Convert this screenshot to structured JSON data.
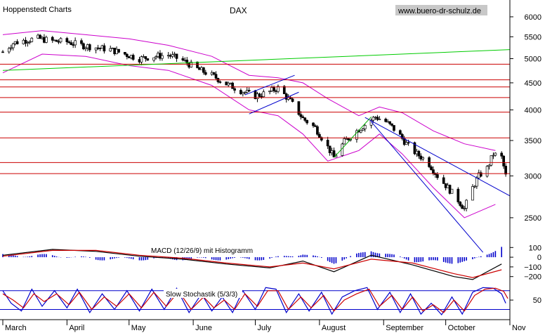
{
  "header": {
    "source": "Hoppenstedt Charts",
    "title": "DAX",
    "url": "www.buero-dr-schulz.de"
  },
  "colors": {
    "background": "#ffffff",
    "axis": "#000000",
    "candle_up": "#ffffff",
    "candle_down": "#000000",
    "bollinger": "#cc00cc",
    "support_resistance": "#cc0000",
    "long_trend": "#00cc00",
    "short_trend": "#00aa00",
    "trend_channel": "#0000cc",
    "macd": "#000000",
    "macd_signal": "#cc0000",
    "histogram": "#0000cc",
    "stoch_k": "#0000cc",
    "stoch_d": "#cc0000",
    "stoch_level": "#0000cc",
    "url_bg": "#c8c8c8"
  },
  "chart_data": [
    {
      "type": "candlestick",
      "name": "price",
      "title": "DAX",
      "y_scale": "log",
      "ylim": [
        2280,
        6300
      ],
      "y_ticks": [
        2500,
        3000,
        3500,
        4000,
        4500,
        5000,
        5500,
        6000
      ],
      "x_range": [
        "2002-03-01",
        "2002-11-01"
      ],
      "x_ticks": [
        {
          "date": "2002-03-01",
          "label": "March"
        },
        {
          "date": "2002-04-01",
          "label": "April"
        },
        {
          "date": "2002-05-01",
          "label": "May"
        },
        {
          "date": "2002-06-01",
          "label": "June"
        },
        {
          "date": "2002-07-01",
          "label": "July"
        },
        {
          "date": "2002-08-01",
          "label": "August"
        },
        {
          "date": "2002-09-01",
          "label": "September"
        },
        {
          "date": "2002-10-01",
          "label": "October"
        },
        {
          "date": "2002-11-01",
          "label": "Nov"
        }
      ],
      "close_path": [
        [
          "2002-03-01",
          5150
        ],
        [
          "2002-03-06",
          5350
        ],
        [
          "2002-03-12",
          5420
        ],
        [
          "2002-03-18",
          5460
        ],
        [
          "2002-03-25",
          5400
        ],
        [
          "2002-04-01",
          5380
        ],
        [
          "2002-04-08",
          5300
        ],
        [
          "2002-04-15",
          5250
        ],
        [
          "2002-04-22",
          5200
        ],
        [
          "2002-04-29",
          5100
        ],
        [
          "2002-05-06",
          5000
        ],
        [
          "2002-05-13",
          5050
        ],
        [
          "2002-05-20",
          5080
        ],
        [
          "2002-05-27",
          4960
        ],
        [
          "2002-06-03",
          4780
        ],
        [
          "2002-06-10",
          4650
        ],
        [
          "2002-06-17",
          4480
        ],
        [
          "2002-06-24",
          4350
        ],
        [
          "2002-07-01",
          4250
        ],
        [
          "2002-07-06",
          4300
        ],
        [
          "2002-07-12",
          4400
        ],
        [
          "2002-07-18",
          4150
        ],
        [
          "2002-07-24",
          3850
        ],
        [
          "2002-07-30",
          3700
        ],
        [
          "2002-08-03",
          3500
        ],
        [
          "2002-08-08",
          3250
        ],
        [
          "2002-08-13",
          3480
        ],
        [
          "2002-08-19",
          3650
        ],
        [
          "2002-08-23",
          3750
        ],
        [
          "2002-08-28",
          3880
        ],
        [
          "2002-09-02",
          3800
        ],
        [
          "2002-09-07",
          3650
        ],
        [
          "2002-09-12",
          3450
        ],
        [
          "2002-09-17",
          3300
        ],
        [
          "2002-09-22",
          3200
        ],
        [
          "2002-09-27",
          3000
        ],
        [
          "2002-10-02",
          2850
        ],
        [
          "2002-10-07",
          2700
        ],
        [
          "2002-10-10",
          2600
        ],
        [
          "2002-10-14",
          2850
        ],
        [
          "2002-10-17",
          3000
        ],
        [
          "2002-10-21",
          3100
        ],
        [
          "2002-10-24",
          3300
        ],
        [
          "2002-10-28",
          3250
        ],
        [
          "2002-10-30",
          3000
        ]
      ],
      "horizontal_levels": [
        4880,
        4560,
        4420,
        4220,
        3960,
        3540,
        3180,
        3030
      ],
      "trendlines": [
        {
          "kind": "long_trend",
          "from": [
            "2002-03-01",
            4750
          ],
          "to": [
            "2002-11-01",
            5200
          ]
        },
        {
          "kind": "trend_channel",
          "from": [
            "2002-08-23",
            3870
          ],
          "to": [
            "2002-11-01",
            2750
          ]
        },
        {
          "kind": "trend_channel",
          "from": [
            "2002-08-26",
            3800
          ],
          "to": [
            "2002-10-19",
            2150
          ]
        },
        {
          "kind": "trend_channel",
          "from": [
            "2002-06-26",
            4270
          ],
          "to": [
            "2002-07-20",
            4650
          ]
        },
        {
          "kind": "trend_channel",
          "from": [
            "2002-06-28",
            3930
          ],
          "to": [
            "2002-07-22",
            4320
          ]
        },
        {
          "kind": "short_trend",
          "from": [
            "2002-08-08",
            3250
          ],
          "to": [
            "2002-08-26",
            3880
          ]
        }
      ],
      "bollinger_upper": [
        [
          "2002-03-01",
          5550
        ],
        [
          "2002-03-20",
          5650
        ],
        [
          "2002-04-10",
          5550
        ],
        [
          "2002-05-01",
          5450
        ],
        [
          "2002-05-20",
          5300
        ],
        [
          "2002-06-10",
          5050
        ],
        [
          "2002-06-28",
          4650
        ],
        [
          "2002-07-12",
          4600
        ],
        [
          "2002-07-24",
          4500
        ],
        [
          "2002-08-05",
          4200
        ],
        [
          "2002-08-20",
          3900
        ],
        [
          "2002-08-30",
          4050
        ],
        [
          "2002-09-10",
          3950
        ],
        [
          "2002-09-25",
          3650
        ],
        [
          "2002-10-10",
          3450
        ],
        [
          "2002-10-25",
          3350
        ]
      ],
      "bollinger_lower": [
        [
          "2002-03-01",
          4700
        ],
        [
          "2002-03-20",
          5100
        ],
        [
          "2002-04-10",
          5050
        ],
        [
          "2002-05-01",
          4850
        ],
        [
          "2002-05-20",
          4750
        ],
        [
          "2002-06-10",
          4450
        ],
        [
          "2002-06-28",
          4000
        ],
        [
          "2002-07-12",
          3900
        ],
        [
          "2002-07-24",
          3600
        ],
        [
          "2002-08-05",
          3200
        ],
        [
          "2002-08-20",
          3350
        ],
        [
          "2002-08-30",
          3600
        ],
        [
          "2002-09-10",
          3300
        ],
        [
          "2002-09-25",
          2850
        ],
        [
          "2002-10-10",
          2500
        ],
        [
          "2002-10-25",
          2650
        ]
      ]
    },
    {
      "type": "line",
      "name": "macd",
      "title": "MACD (12/26/9) mit Histogramm",
      "ylim": [
        -260,
        160
      ],
      "y_ticks": [
        100,
        0,
        -100,
        -200
      ],
      "y_tick_labels": [
        "100",
        "0",
        "−100",
        "−200"
      ],
      "series": [
        {
          "key": "macd",
          "values": [
            [
              "2002-03-01",
              20
            ],
            [
              "2002-03-25",
              80
            ],
            [
              "2002-04-15",
              60
            ],
            [
              "2002-05-06",
              10
            ],
            [
              "2002-05-27",
              -20
            ],
            [
              "2002-06-17",
              -70
            ],
            [
              "2002-07-08",
              -110
            ],
            [
              "2002-07-24",
              -40
            ],
            [
              "2002-08-08",
              -150
            ],
            [
              "2002-08-26",
              20
            ],
            [
              "2002-09-15",
              -80
            ],
            [
              "2002-10-05",
              -200
            ],
            [
              "2002-10-14",
              -230
            ],
            [
              "2002-10-28",
              -70
            ]
          ]
        },
        {
          "key": "macd_signal",
          "values": [
            [
              "2002-03-01",
              10
            ],
            [
              "2002-03-25",
              70
            ],
            [
              "2002-04-15",
              70
            ],
            [
              "2002-05-06",
              20
            ],
            [
              "2002-05-27",
              -10
            ],
            [
              "2002-06-17",
              -60
            ],
            [
              "2002-07-08",
              -100
            ],
            [
              "2002-07-24",
              -60
            ],
            [
              "2002-08-08",
              -120
            ],
            [
              "2002-08-26",
              -20
            ],
            [
              "2002-09-15",
              -60
            ],
            [
              "2002-10-05",
              -170
            ],
            [
              "2002-10-14",
              -210
            ],
            [
              "2002-10-28",
              -130
            ]
          ]
        }
      ]
    },
    {
      "type": "line",
      "name": "stochastic",
      "title": "Slow Stochastik (5/3/3)",
      "ylim": [
        -6,
        102
      ],
      "y_ticks": [
        50
      ],
      "levels": [
        80,
        20
      ],
      "series": [
        {
          "key": "stoch_k",
          "values": [
            [
              "2002-03-01",
              80
            ],
            [
              "2002-03-05",
              40
            ],
            [
              "2002-03-10",
              15
            ],
            [
              "2002-03-15",
              85
            ],
            [
              "2002-03-20",
              30
            ],
            [
              "2002-03-26",
              80
            ],
            [
              "2002-04-01",
              25
            ],
            [
              "2002-04-06",
              85
            ],
            [
              "2002-04-12",
              10
            ],
            [
              "2002-04-18",
              70
            ],
            [
              "2002-04-24",
              20
            ],
            [
              "2002-04-30",
              80
            ],
            [
              "2002-05-06",
              15
            ],
            [
              "2002-05-12",
              85
            ],
            [
              "2002-05-18",
              20
            ],
            [
              "2002-05-24",
              88
            ],
            [
              "2002-05-30",
              10
            ],
            [
              "2002-06-05",
              70
            ],
            [
              "2002-06-10",
              15
            ],
            [
              "2002-06-15",
              60
            ],
            [
              "2002-06-20",
              10
            ],
            [
              "2002-06-25",
              80
            ],
            [
              "2002-07-01",
              20
            ],
            [
              "2002-07-06",
              90
            ],
            [
              "2002-07-11",
              85
            ],
            [
              "2002-07-16",
              10
            ],
            [
              "2002-07-22",
              70
            ],
            [
              "2002-07-27",
              15
            ],
            [
              "2002-08-02",
              75
            ],
            [
              "2002-08-07",
              5
            ],
            [
              "2002-08-12",
              60
            ],
            [
              "2002-08-18",
              80
            ],
            [
              "2002-08-24",
              90
            ],
            [
              "2002-08-29",
              20
            ],
            [
              "2002-09-04",
              75
            ],
            [
              "2002-09-09",
              10
            ],
            [
              "2002-09-14",
              70
            ],
            [
              "2002-09-19",
              5
            ],
            [
              "2002-09-24",
              40
            ],
            [
              "2002-09-29",
              3
            ],
            [
              "2002-10-04",
              60
            ],
            [
              "2002-10-09",
              5
            ],
            [
              "2002-10-14",
              75
            ],
            [
              "2002-10-19",
              90
            ],
            [
              "2002-10-24",
              88
            ],
            [
              "2002-10-28",
              70
            ],
            [
              "2002-10-30",
              40
            ]
          ]
        },
        {
          "key": "stoch_d",
          "values": [
            [
              "2002-03-01",
              70
            ],
            [
              "2002-03-06",
              50
            ],
            [
              "2002-03-11",
              25
            ],
            [
              "2002-03-16",
              70
            ],
            [
              "2002-03-21",
              45
            ],
            [
              "2002-03-27",
              70
            ],
            [
              "2002-04-02",
              35
            ],
            [
              "2002-04-07",
              75
            ],
            [
              "2002-04-13",
              20
            ],
            [
              "2002-04-19",
              60
            ],
            [
              "2002-04-25",
              30
            ],
            [
              "2002-05-01",
              70
            ],
            [
              "2002-05-07",
              25
            ],
            [
              "2002-05-13",
              75
            ],
            [
              "2002-05-19",
              30
            ],
            [
              "2002-05-25",
              78
            ],
            [
              "2002-05-31",
              20
            ],
            [
              "2002-06-06",
              60
            ],
            [
              "2002-06-11",
              25
            ],
            [
              "2002-06-16",
              50
            ],
            [
              "2002-06-21",
              20
            ],
            [
              "2002-06-26",
              70
            ],
            [
              "2002-07-02",
              30
            ],
            [
              "2002-07-07",
              80
            ],
            [
              "2002-07-12",
              80
            ],
            [
              "2002-07-17",
              20
            ],
            [
              "2002-07-23",
              60
            ],
            [
              "2002-07-28",
              25
            ],
            [
              "2002-08-03",
              65
            ],
            [
              "2002-08-08",
              15
            ],
            [
              "2002-08-13",
              50
            ],
            [
              "2002-08-19",
              70
            ],
            [
              "2002-08-25",
              85
            ],
            [
              "2002-08-30",
              30
            ],
            [
              "2002-09-05",
              65
            ],
            [
              "2002-09-10",
              20
            ],
            [
              "2002-09-15",
              60
            ],
            [
              "2002-09-20",
              15
            ],
            [
              "2002-09-25",
              35
            ],
            [
              "2002-09-30",
              10
            ],
            [
              "2002-10-05",
              50
            ],
            [
              "2002-10-10",
              15
            ],
            [
              "2002-10-15",
              65
            ],
            [
              "2002-10-20",
              85
            ],
            [
              "2002-10-25",
              88
            ],
            [
              "2002-10-29",
              78
            ],
            [
              "2002-10-31",
              55
            ]
          ]
        }
      ]
    }
  ]
}
